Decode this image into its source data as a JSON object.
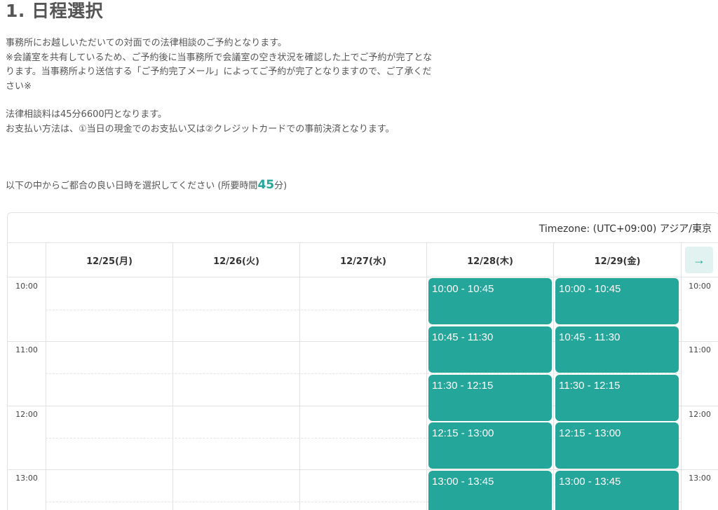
{
  "section": {
    "title": "1. 日程選択"
  },
  "description": {
    "line1": "事務所にお越しいただいての対面での法律相談のご予約となります。",
    "line2": "※会議室を共有しているため、ご予約後に当事務所で会議室の空き状況を確認した上でご予約が完了となります。当事務所より送信する「ご予約完了メール」によってご予約が完了となりますので、ご了承ください※",
    "line3": "法律相談料は45分6600円となります。",
    "line4": "お支払い方法は、①当日の現金でのお支払い又は②クレジットカードでの事前決済となります。"
  },
  "prompt": {
    "text": "以下の中からご都合の良い日時を選択してください (所要時間",
    "minutes": "45",
    "suffix": "分)"
  },
  "calendar": {
    "timezone": "Timezone: (UTC+09:00) アジア/東京",
    "days": [
      {
        "label": "12/25(月)"
      },
      {
        "label": "12/26(火)"
      },
      {
        "label": "12/27(水)"
      },
      {
        "label": "12/28(木)"
      },
      {
        "label": "12/29(金)"
      }
    ],
    "next_icon": "arrow-right-icon",
    "next_glyph": "→",
    "times_left": [
      "10:00",
      "11:00",
      "12:00",
      "13:00"
    ],
    "times_right": [
      "10:00",
      "11:00",
      "12:00",
      "13:00"
    ],
    "slots_thu": [
      "10:00 - 10:45",
      "10:45 - 11:30",
      "11:30 - 12:15",
      "12:15 - 13:00",
      "13:00 - 13:45"
    ],
    "slots_fri": [
      "10:00 - 10:45",
      "10:45 - 11:30",
      "11:30 - 12:15",
      "12:15 - 13:00",
      "13:00 - 13:45"
    ],
    "accent_color": "#25a69a"
  }
}
